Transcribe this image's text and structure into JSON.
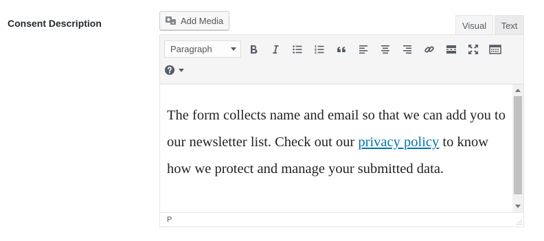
{
  "field": {
    "label": "Consent Description"
  },
  "media": {
    "add_media_label": "Add Media",
    "icon": "add-media-icon"
  },
  "tabs": {
    "visual": "Visual",
    "text": "Text"
  },
  "toolbar": {
    "format_selected": "Paragraph",
    "buttons": [
      "bold-icon",
      "italic-icon",
      "bullet-list-icon",
      "numbered-list-icon",
      "blockquote-icon",
      "align-left-icon",
      "align-center-icon",
      "align-right-icon",
      "link-icon",
      "read-more-icon",
      "fullscreen-icon",
      "toolbar-toggle-icon",
      "help-icon"
    ]
  },
  "content": {
    "text_before": "The form collects name and email so that we can add you to our newsletter list. Check out our ",
    "link_text": "privacy policy",
    "text_after": " to know how we protect and manage your submitted data."
  },
  "statusbar": {
    "path": "P"
  },
  "colors": {
    "link": "#0073aa",
    "toolbar_bg": "#f5f5f5",
    "text": "#222222"
  }
}
